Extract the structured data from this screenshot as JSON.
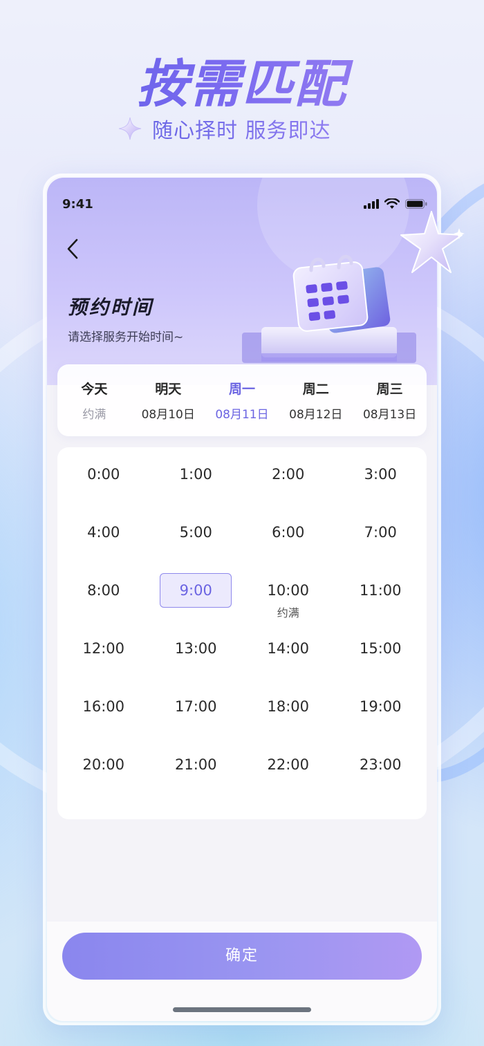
{
  "hero": {
    "title": "按需匹配",
    "subtitle": "随心择时 服务即达"
  },
  "status_bar": {
    "time": "9:41"
  },
  "header": {
    "title": "预约时间",
    "subtitle": "请选择服务开始时间~"
  },
  "days": [
    {
      "name": "今天",
      "date": "约满",
      "state": "full"
    },
    {
      "name": "明天",
      "date": "08月10日",
      "state": "normal"
    },
    {
      "name": "周一",
      "date": "08月11日",
      "state": "active"
    },
    {
      "name": "周二",
      "date": "08月12日",
      "state": "normal"
    },
    {
      "name": "周三",
      "date": "08月13日",
      "state": "normal"
    }
  ],
  "slots": [
    {
      "time": "0:00"
    },
    {
      "time": "1:00"
    },
    {
      "time": "2:00"
    },
    {
      "time": "3:00"
    },
    {
      "time": "4:00"
    },
    {
      "time": "5:00"
    },
    {
      "time": "6:00"
    },
    {
      "time": "7:00"
    },
    {
      "time": "8:00"
    },
    {
      "time": "9:00",
      "selected": true
    },
    {
      "time": "10:00",
      "note": "约满"
    },
    {
      "time": "11:00"
    },
    {
      "time": "12:00"
    },
    {
      "time": "13:00"
    },
    {
      "time": "14:00"
    },
    {
      "time": "15:00"
    },
    {
      "time": "16:00"
    },
    {
      "time": "17:00"
    },
    {
      "time": "18:00"
    },
    {
      "time": "19:00"
    },
    {
      "time": "20:00"
    },
    {
      "time": "21:00"
    },
    {
      "time": "22:00"
    },
    {
      "time": "23:00"
    }
  ],
  "confirm_label": "确定",
  "colors": {
    "accent": "#6b64e2",
    "header_bg": "#c6bff9",
    "button_start": "#8a86ee",
    "button_end": "#b099f3"
  },
  "icons": {
    "back": "chevron-left-icon",
    "sparkle": "sparkle-icon",
    "signal": "signal-icon",
    "wifi": "wifi-icon",
    "battery": "battery-icon",
    "calendar": "calendar-illustration",
    "star": "star-3d-icon"
  }
}
